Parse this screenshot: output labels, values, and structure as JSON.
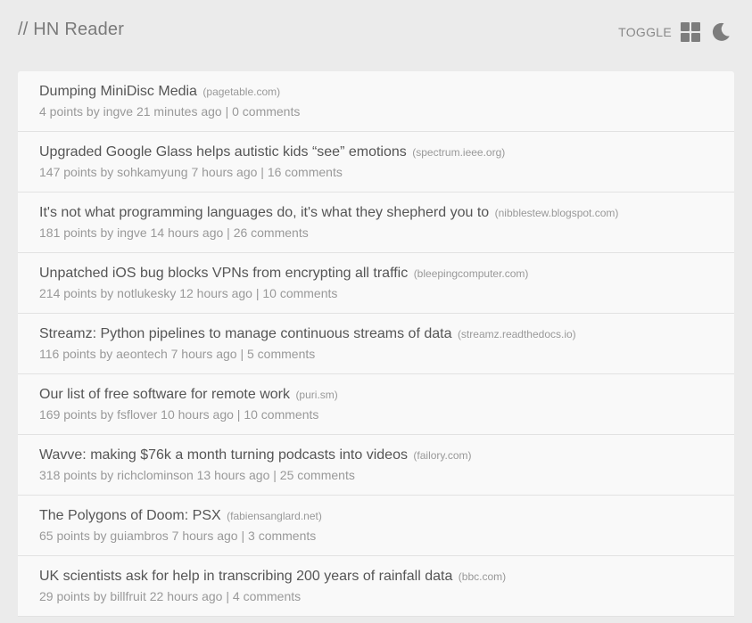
{
  "header": {
    "brand": "// HN Reader",
    "toggle_label": "TOGGLE",
    "grid_icon": "grid-icon",
    "moon_icon": "moon-icon"
  },
  "stories": [
    {
      "title": "Dumping MiniDisc Media",
      "domain": "(pagetable.com)",
      "info": "4 points by ingve 21 minutes ago |",
      "comments": "0 comments"
    },
    {
      "title": "Upgraded Google Glass helps autistic kids “see” emotions",
      "domain": "(spectrum.ieee.org)",
      "info": "147 points by sohkamyung 7 hours ago |",
      "comments": "16 comments"
    },
    {
      "title": "It's not what programming languages do, it's what they shepherd you to",
      "domain": "(nibblestew.blogspot.com)",
      "info": "181 points by ingve 14 hours ago |",
      "comments": "26 comments"
    },
    {
      "title": "Unpatched iOS bug blocks VPNs from encrypting all traffic",
      "domain": "(bleepingcomputer.com)",
      "info": "214 points by notlukesky 12 hours ago |",
      "comments": "10 comments"
    },
    {
      "title": "Streamz: Python pipelines to manage continuous streams of data",
      "domain": "(streamz.readthedocs.io)",
      "info": "116 points by aeontech 7 hours ago |",
      "comments": "5 comments"
    },
    {
      "title": "Our list of free software for remote work",
      "domain": "(puri.sm)",
      "info": "169 points by fsflover 10 hours ago |",
      "comments": "10 comments"
    },
    {
      "title": "Wavve: making $76k a month turning podcasts into videos",
      "domain": "(failory.com)",
      "info": "318 points by richclominson 13 hours ago |",
      "comments": "25 comments"
    },
    {
      "title": "The Polygons of Doom: PSX",
      "domain": "(fabiensanglard.net)",
      "info": "65 points by guiambros 7 hours ago |",
      "comments": "3 comments"
    },
    {
      "title": "UK scientists ask for help in transcribing 200 years of rainfall data",
      "domain": "(bbc.com)",
      "info": "29 points by billfruit 22 hours ago |",
      "comments": "4 comments"
    }
  ]
}
